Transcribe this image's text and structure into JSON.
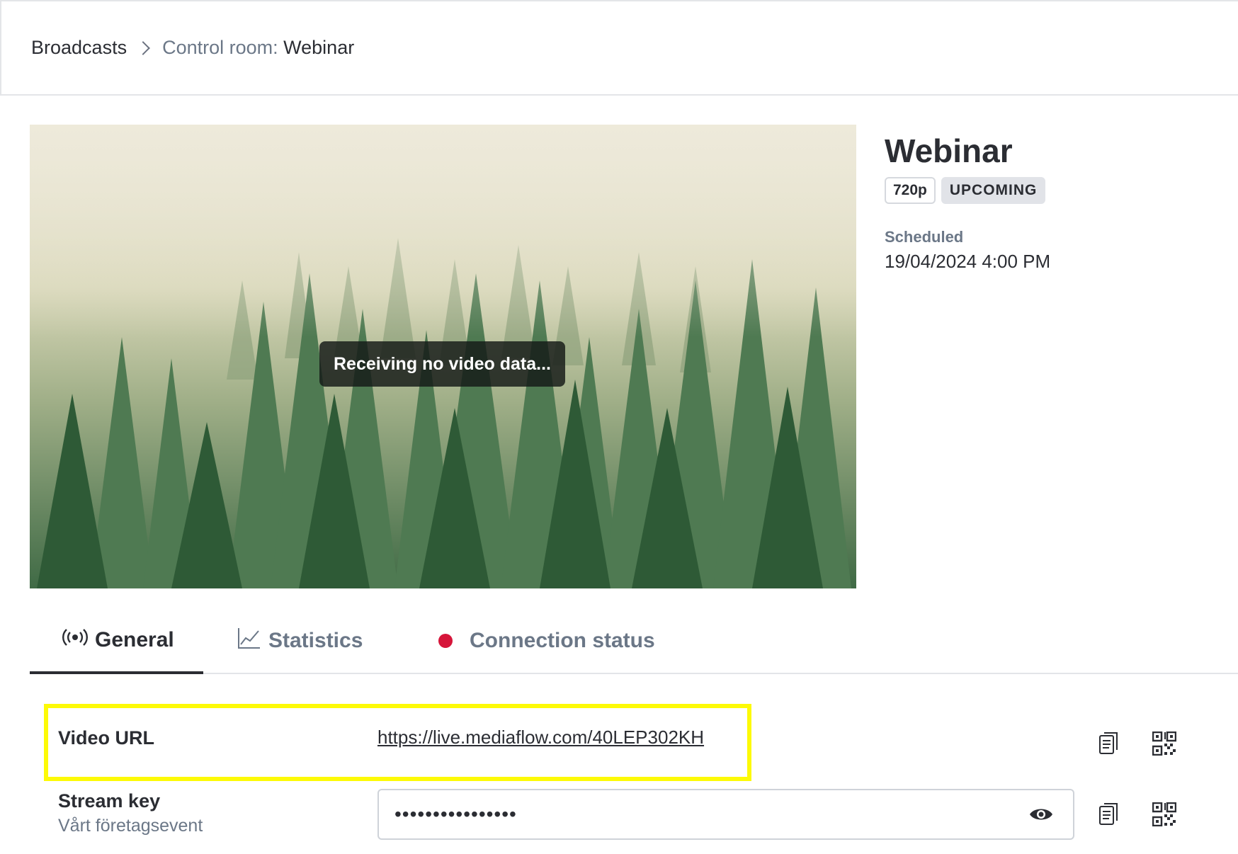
{
  "breadcrumb": {
    "root": "Broadcasts",
    "prefix": "Control room:",
    "current": "Webinar"
  },
  "video": {
    "status_message": "Receiving no video data..."
  },
  "broadcast": {
    "title": "Webinar",
    "resolution": "720p",
    "status": "UPCOMING",
    "scheduled_label": "Scheduled",
    "scheduled_value": "19/04/2024 4:00 PM"
  },
  "tabs": [
    {
      "label": "General",
      "icon": "broadcast-icon",
      "active": true
    },
    {
      "label": "Statistics",
      "icon": "chart-line-icon",
      "active": false
    },
    {
      "label": "Connection status",
      "icon": "status-dot",
      "active": false
    }
  ],
  "fields": {
    "video_url": {
      "label": "Video URL",
      "value": "https://live.mediaflow.com/40LEP302KH"
    },
    "stream_key": {
      "label": "Stream key",
      "sublabel": "Vårt företagsevent",
      "masked_value": "••••••••••••••••"
    }
  },
  "colors": {
    "highlight": "#fdfa07",
    "status_dot": "#d6153a",
    "badge_bg": "#e1e3e8",
    "text": "#2b2d33",
    "muted": "#6b7787"
  }
}
